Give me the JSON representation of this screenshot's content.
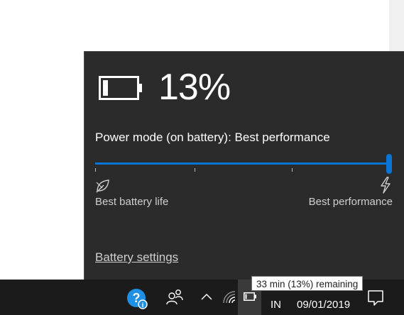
{
  "battery": {
    "percent_text": "13%",
    "icon": "battery-icon",
    "level": 0.13
  },
  "power_mode": {
    "label": "Power mode (on battery): Best performance",
    "slider_value": "Best performance",
    "left_label": "Best battery life",
    "right_label": "Best performance",
    "left_icon": "leaf-icon",
    "right_icon": "lightning-icon"
  },
  "settings_link": "Battery settings",
  "tooltip": "33 min (13%) remaining",
  "taskbar": {
    "language": "IN",
    "date": "09/01/2019",
    "icons": [
      "help-icon",
      "people-icon",
      "chevron-up-icon",
      "wifi-icon",
      "battery-icon",
      "notification-icon"
    ]
  },
  "colors": {
    "accent": "#0a74d6",
    "flyout_bg": "#2b2b2b",
    "taskbar_bg": "#1b1b1b"
  }
}
